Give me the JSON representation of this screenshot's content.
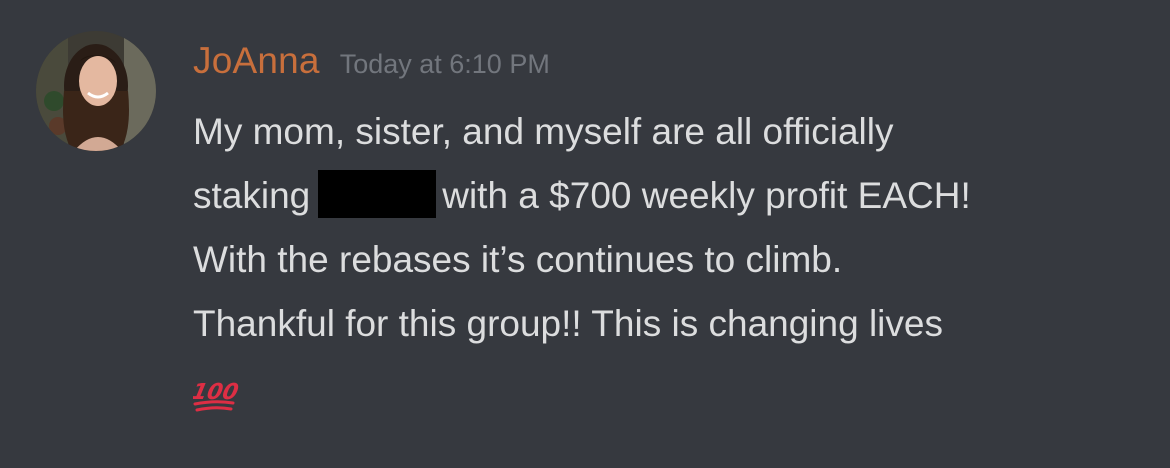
{
  "message": {
    "author": "JoAnna",
    "timestamp": "Today at 6:10 PM",
    "lines": {
      "line1": "My mom, sister, and myself are all officially",
      "line2_before": "staking",
      "line2_after": "with a $700 weekly profit EACH!",
      "line3": "With the rebases it’s continues to climb.",
      "line4": "Thankful for this group!! This is changing lives"
    },
    "emoji": "hundred-points-emoji",
    "emoji_text": "100"
  },
  "colors": {
    "background": "#36393f",
    "username": "#c86f3c",
    "timestamp": "#72767d",
    "message_text": "#dcddde",
    "redaction": "#000000",
    "emoji": "#dd2e44"
  }
}
